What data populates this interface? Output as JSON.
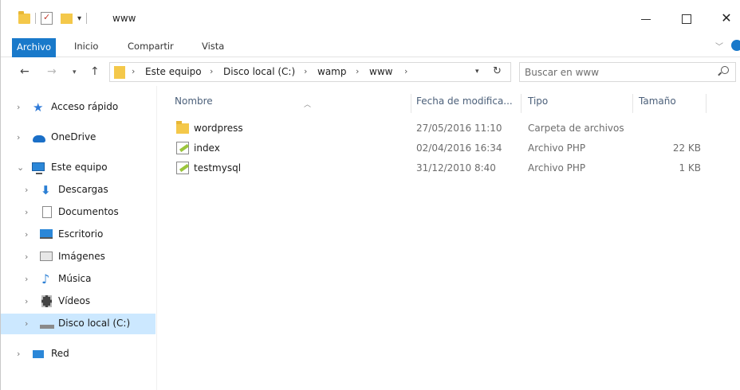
{
  "window": {
    "title": "www"
  },
  "ribbon": {
    "tabs": [
      "Archivo",
      "Inicio",
      "Compartir",
      "Vista"
    ]
  },
  "address": {
    "crumbs": [
      "Este equipo",
      "Disco local (C:)",
      "wamp",
      "www"
    ]
  },
  "search": {
    "placeholder": "Buscar en www"
  },
  "navpane": {
    "items": [
      {
        "label": "Acceso rápido",
        "icon": "star-icon"
      },
      {
        "label": "OneDrive",
        "icon": "cloud-icon"
      },
      {
        "label": "Este equipo",
        "icon": "pc-icon"
      },
      {
        "label": "Descargas",
        "icon": "download-icon"
      },
      {
        "label": "Documentos",
        "icon": "documents-icon"
      },
      {
        "label": "Escritorio",
        "icon": "desktop-icon"
      },
      {
        "label": "Imágenes",
        "icon": "pictures-icon"
      },
      {
        "label": "Música",
        "icon": "music-icon"
      },
      {
        "label": "Vídeos",
        "icon": "videos-icon"
      },
      {
        "label": "Disco local (C:)",
        "icon": "disk-icon"
      },
      {
        "label": "Red",
        "icon": "network-icon"
      }
    ]
  },
  "columns": {
    "name": "Nombre",
    "date": "Fecha de modifica...",
    "type": "Tipo",
    "size": "Tamaño"
  },
  "files": [
    {
      "name": "wordpress",
      "date": "27/05/2016 11:10",
      "type": "Carpeta de archivos",
      "size": "",
      "icon": "folder-icon"
    },
    {
      "name": "index",
      "date": "02/04/2016 16:34",
      "type": "Archivo PHP",
      "size": "22 KB",
      "icon": "php-file-icon"
    },
    {
      "name": "testmysql",
      "date": "31/12/2010 8:40",
      "type": "Archivo PHP",
      "size": "1 KB",
      "icon": "php-file-icon"
    }
  ],
  "colors": {
    "accent": "#1979ca",
    "selection": "#cce8ff",
    "folder": "#f4c84a"
  }
}
